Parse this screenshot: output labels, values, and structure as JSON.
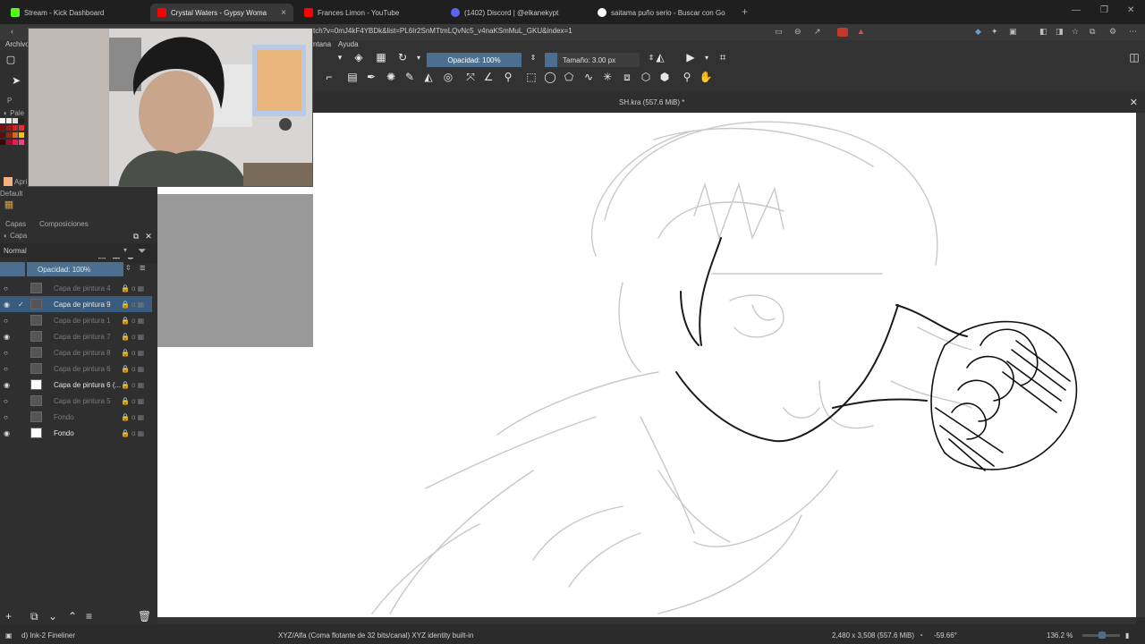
{
  "browser": {
    "tabs": [
      {
        "label": "Stream - Kick Dashboard",
        "favicon": "kick-icon",
        "color": "#53fc18"
      },
      {
        "label": "Crystal Waters - Gypsy Woma",
        "favicon": "youtube-icon",
        "color": "#ff0000"
      },
      {
        "label": "Frances Limon - YouTube",
        "favicon": "youtube-icon",
        "color": "#ff0000"
      },
      {
        "label": "(1402) Discord | @elkanekypt",
        "favicon": "discord-icon",
        "color": "#5865f2"
      },
      {
        "label": "saitama puño serio - Buscar con Go",
        "favicon": "google-icon",
        "color": "#ffffff"
      }
    ],
    "new_tab": "+",
    "address": "tch?v=0mJ4kF4YBDk&list=PL6Ir2SnMTtmLQvNc5_v4naKSmMuL_GKU&index=1"
  },
  "menu": {
    "items": [
      "Archivo",
      "ntana",
      "Ayuda"
    ]
  },
  "toolbar": {
    "opacity": "Opacidad: 100%",
    "size": "Tamaño: 3.00 px"
  },
  "document": {
    "title": "SH.kra (557.6 MiB) *"
  },
  "dock": {
    "palette_label": "Pale",
    "default_label": "Default",
    "apri_label": "Apri",
    "p_label": "P",
    "tabs": [
      "Capas",
      "Composiciones"
    ],
    "capa_label": "Capa",
    "blend_mode": "Normal",
    "opacity": "Opacidad:  100%"
  },
  "layers": [
    {
      "name": "Capa de pintura 4",
      "visible": false,
      "selected": false,
      "dim": true,
      "thumb": "dark"
    },
    {
      "name": "Capa de pintura 9",
      "visible": true,
      "selected": true,
      "dim": false,
      "thumb": "dark"
    },
    {
      "name": "Capa de pintura 1",
      "visible": false,
      "selected": false,
      "dim": true,
      "thumb": "dark"
    },
    {
      "name": "Capa de pintura 7",
      "visible": true,
      "selected": false,
      "dim": true,
      "thumb": "dark"
    },
    {
      "name": "Capa de pintura 8",
      "visible": false,
      "selected": false,
      "dim": true,
      "thumb": "dark"
    },
    {
      "name": "Capa de pintura 6",
      "visible": false,
      "selected": false,
      "dim": true,
      "thumb": "dark"
    },
    {
      "name": "Capa de pintura 6 (...",
      "visible": true,
      "selected": false,
      "dim": false,
      "thumb": "white"
    },
    {
      "name": "Capa de pintura 5",
      "visible": false,
      "selected": false,
      "dim": true,
      "thumb": "dark"
    },
    {
      "name": "Fondo",
      "visible": false,
      "selected": false,
      "dim": true,
      "thumb": "dark"
    },
    {
      "name": "Fondo",
      "visible": true,
      "selected": false,
      "dim": false,
      "thumb": "white"
    }
  ],
  "status": {
    "brush": "d) Ink-2 Fineliner",
    "colorspace": "XYZ/Alfa (Coma flotante de 32 bits/canal)  XYZ identity built-in",
    "dimensions": "2,480 x 3,508 (557.6 MiB)",
    "rotation": "-59.66°",
    "zoom": "136.2 %"
  },
  "colors": {
    "accent": "#4d6f8f",
    "selection": "#385b7e",
    "panel": "#2f2f2f",
    "canvas": "#ffffff"
  }
}
